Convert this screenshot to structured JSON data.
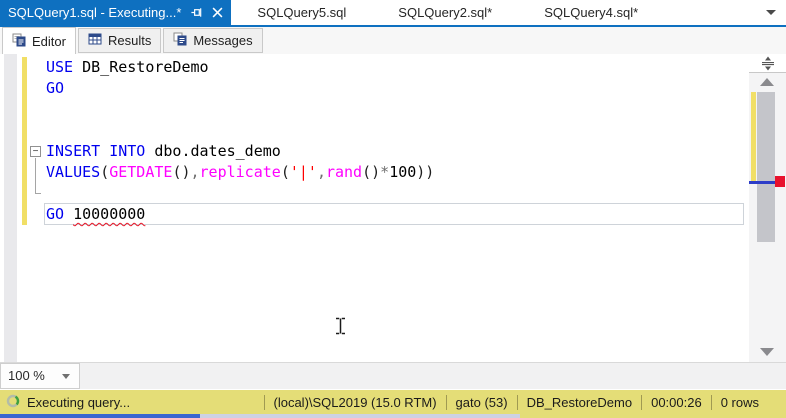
{
  "doc_tabs": {
    "tabs": [
      {
        "label": "SQLQuery1.sql -  Executing...*",
        "active": true
      },
      {
        "label": "SQLQuery5.sql",
        "active": false
      },
      {
        "label": "SQLQuery2.sql*",
        "active": false
      },
      {
        "label": "SQLQuery4.sql*",
        "active": false
      }
    ]
  },
  "view_tabs": [
    {
      "label": "Editor",
      "active": true
    },
    {
      "label": "Results",
      "active": false
    },
    {
      "label": "Messages",
      "active": false
    }
  ],
  "editor": {
    "zoom_value": "100 %",
    "lines": [
      {
        "tokens": [
          {
            "c": "kw",
            "t": "USE"
          },
          {
            "c": "id",
            "t": " DB_RestoreDemo"
          }
        ]
      },
      {
        "tokens": [
          {
            "c": "kw",
            "t": "GO"
          }
        ]
      },
      {
        "tokens": []
      },
      {
        "tokens": []
      },
      {
        "tokens": [
          {
            "c": "kw",
            "t": "INSERT"
          },
          {
            "c": "id",
            "t": " "
          },
          {
            "c": "kw",
            "t": "INTO"
          },
          {
            "c": "id",
            "t": " dbo.dates_demo"
          }
        ]
      },
      {
        "tokens": [
          {
            "c": "kw",
            "t": "VALUES"
          },
          {
            "c": "pr",
            "t": "("
          },
          {
            "c": "fn",
            "t": "GETDATE"
          },
          {
            "c": "pr",
            "t": "()"
          },
          {
            "c": "op",
            "t": ","
          },
          {
            "c": "fn",
            "t": "replicate"
          },
          {
            "c": "pr",
            "t": "("
          },
          {
            "c": "str",
            "t": "'|'"
          },
          {
            "c": "op",
            "t": ","
          },
          {
            "c": "fn",
            "t": "rand"
          },
          {
            "c": "pr",
            "t": "()"
          },
          {
            "c": "op",
            "t": "*"
          },
          {
            "c": "id",
            "t": "100"
          },
          {
            "c": "pr",
            "t": "))"
          }
        ]
      },
      {
        "tokens": []
      },
      {
        "tokens": [
          {
            "c": "kw",
            "t": "GO"
          },
          {
            "c": "id",
            "t": " "
          },
          {
            "c": "err",
            "t": "10000000"
          }
        ]
      }
    ]
  },
  "status_bar": {
    "message": "Executing query...",
    "server": "(local)\\SQL2019 (15.0 RTM)",
    "login": "gato (53)",
    "database": "DB_RestoreDemo",
    "elapsed_time": "00:00:26",
    "row_count": "0 rows"
  },
  "colors": {
    "active_tab_blue": "#0E70C0",
    "status_yellow": "#E4DD77",
    "keyword_blue": "#0000EE",
    "system_function_magenta": "#FF00FF",
    "string_red": "#FF0000",
    "change_track_yellow": "#F1DF66",
    "error_red": "#E81123",
    "caret_map_blue": "#2D3DC8"
  }
}
